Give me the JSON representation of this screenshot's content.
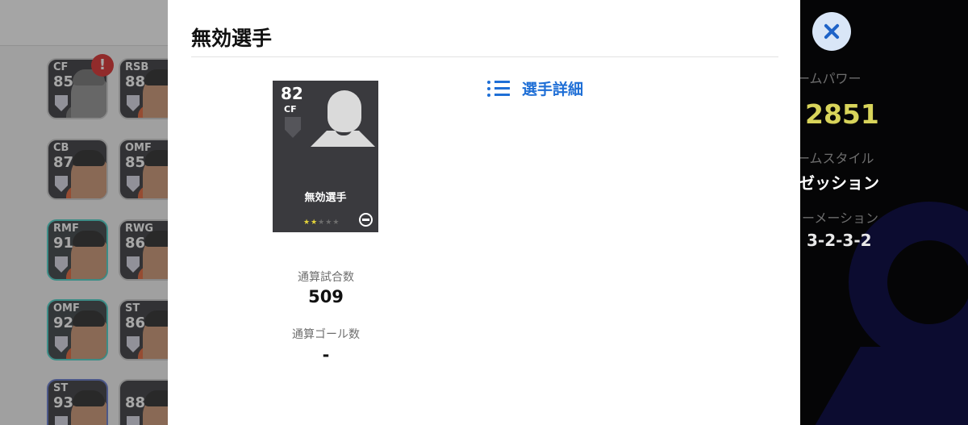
{
  "modal": {
    "title": "無効選手",
    "details_link": "選手詳細"
  },
  "player_card": {
    "rating": "82",
    "position": "CF",
    "name": "無効選手",
    "stars_filled": 2,
    "stars_total": 5
  },
  "stats": {
    "appearances_label": "通算試合数",
    "appearances_value": "509",
    "goals_label": "通算ゴール数",
    "goals_value": "-"
  },
  "squad_list": [
    {
      "position": "CF",
      "rating": "85",
      "style": "grey"
    },
    {
      "position": "RSB",
      "rating": "88",
      "style": "default"
    },
    {
      "position": "CB",
      "rating": "87",
      "style": "default"
    },
    {
      "position": "OMF",
      "rating": "85",
      "style": "default"
    },
    {
      "position": "RMF",
      "rating": "91",
      "style": "teal"
    },
    {
      "position": "RWG",
      "rating": "86",
      "style": "default"
    },
    {
      "position": "OMF",
      "rating": "92",
      "style": "teal"
    },
    {
      "position": "ST",
      "rating": "86",
      "style": "default"
    },
    {
      "position": "ST",
      "rating": "93",
      "style": "blue"
    },
    {
      "position": "",
      "rating": "88",
      "style": "default"
    }
  ],
  "alert_badge": "!",
  "team_info": {
    "power_label": "チームパワー",
    "power_value": "2851",
    "style_label": "チームスタイル",
    "style_value": "ポゼッション",
    "formation_label": "フォーメーション",
    "formation_value": "3-2-3-2"
  },
  "colors": {
    "accent": "#1f6fd6",
    "power": "#d8d45a",
    "star_on": "#e5d43a"
  }
}
